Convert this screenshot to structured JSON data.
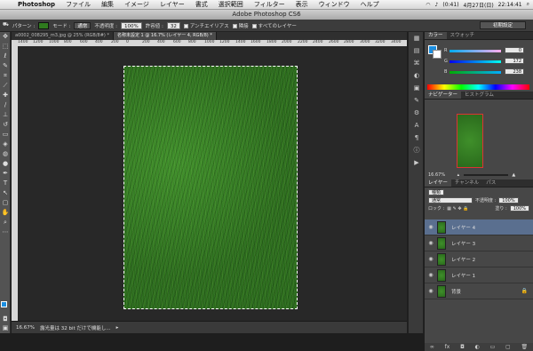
{
  "menubar": {
    "app": "Photoshop",
    "items": [
      "ファイル",
      "編集",
      "イメージ",
      "レイヤー",
      "書式",
      "選択範囲",
      "フィルター",
      "表示",
      "ウィンドウ",
      "ヘルプ"
    ],
    "battery": "(0:41)",
    "date": "4月27日(日)",
    "time": "22:14:41"
  },
  "title": "Adobe Photoshop CS6",
  "options": {
    "pattern_label": "パターン :",
    "mode_label": "モード :",
    "mode_value": "通常",
    "opacity_label": "不透明度 :",
    "opacity_value": "100%",
    "tolerance_label": "許容値 :",
    "tolerance_value": "32",
    "antialias": "アンチエイリアス",
    "contiguous": "隣接",
    "all_layers": "すべてのレイヤー",
    "workspace": "初期設定"
  },
  "doctabs": [
    "a0002_008295_m3.jpg @ 25% (RGB/8#) *",
    "名称未設定 1 @ 16.7% (レイヤー 4, RGB/8) *"
  ],
  "ruler": [
    "1400",
    "1200",
    "1000",
    "800",
    "600",
    "400",
    "200",
    "0",
    "200",
    "400",
    "600",
    "800",
    "1000",
    "1200",
    "1400",
    "1600",
    "1800",
    "2000",
    "2200",
    "2400",
    "2600",
    "2800",
    "3000",
    "3200",
    "3400"
  ],
  "status": {
    "zoom": "16.67%",
    "message": "露光量は 32 bit だけで機能し..."
  },
  "color": {
    "tabs": [
      "カラー",
      "スウォッチ"
    ],
    "r_label": "R",
    "g_label": "G",
    "b_label": "B",
    "r": "0",
    "g": "172",
    "b": "238"
  },
  "navigator": {
    "tabs": [
      "ナビゲーター",
      "ヒストグラム"
    ],
    "zoom": "16.67%"
  },
  "layers": {
    "tabs": [
      "レイヤー",
      "チャンネル",
      "パス"
    ],
    "kind": "種類",
    "blend": "通常",
    "opacity_label": "不透明度 :",
    "opacity": "100%",
    "lock_label": "ロック :",
    "fill_label": "塗り :",
    "fill": "100%",
    "items": [
      {
        "name": "レイヤー 4"
      },
      {
        "name": "レイヤー 3"
      },
      {
        "name": "レイヤー 2"
      },
      {
        "name": "レイヤー 1"
      },
      {
        "name": "背景"
      }
    ]
  },
  "colors": {
    "foreground": "#1b8ee0",
    "background": "#ffffff",
    "grass": "#2f7a1e"
  }
}
